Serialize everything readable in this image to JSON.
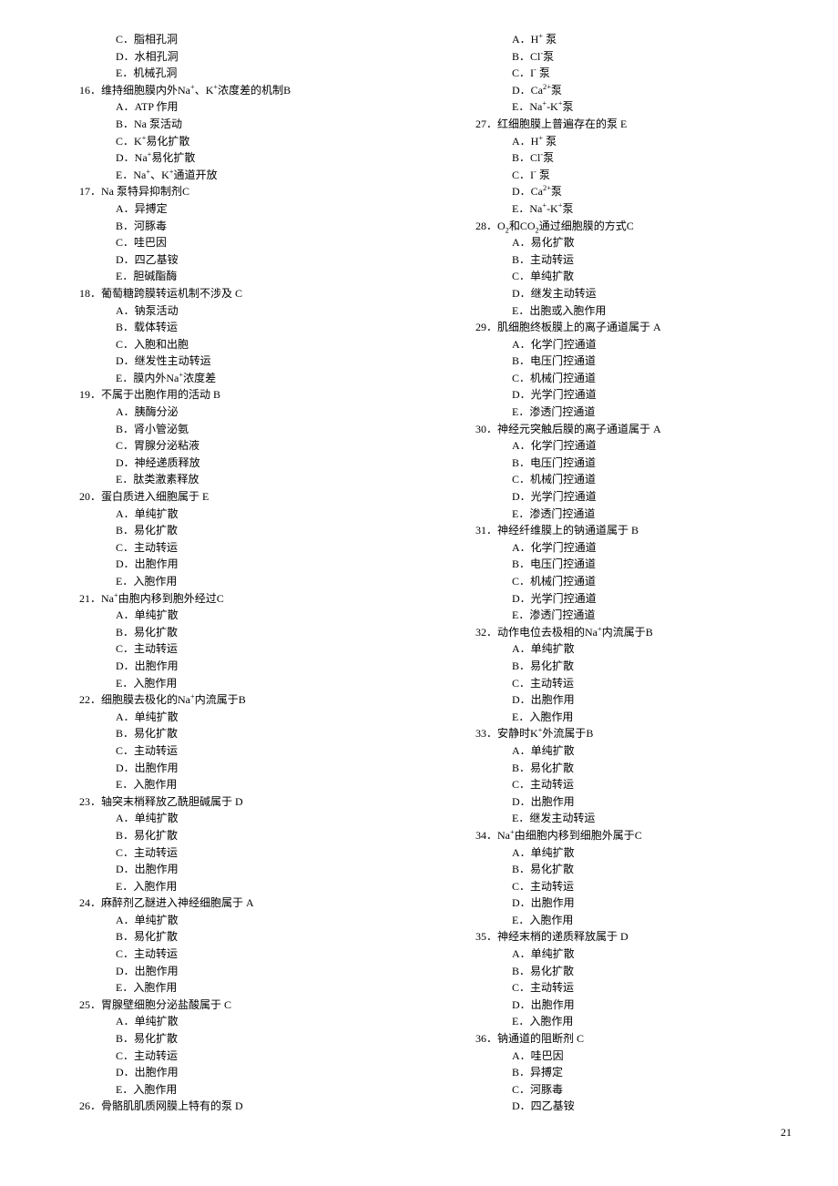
{
  "page_number": "21",
  "left_column": [
    {
      "type": "option",
      "key": "C",
      "text": "脂相孔洞"
    },
    {
      "type": "option",
      "key": "D",
      "text": "水相孔洞"
    },
    {
      "type": "option",
      "key": "E",
      "text": "机械孔洞"
    },
    {
      "type": "question",
      "num": "16",
      "text": "维持细胞膜内外Na<sup>+</sup>、K<sup>+</sup>浓度差的机制B"
    },
    {
      "type": "option",
      "key": "A",
      "text": "ATP 作用"
    },
    {
      "type": "option",
      "key": "B",
      "text": "Na 泵活动"
    },
    {
      "type": "option",
      "key": "C",
      "text": "K<sup>+</sup>易化扩散"
    },
    {
      "type": "option",
      "key": "D",
      "text": "Na<sup>+</sup>易化扩散"
    },
    {
      "type": "option",
      "key": "E",
      "text": "Na<sup>+</sup>、K<sup>+</sup>通道开放"
    },
    {
      "type": "question",
      "num": "17",
      "text": "Na 泵特异抑制剂C"
    },
    {
      "type": "option",
      "key": "A",
      "text": "异搏定"
    },
    {
      "type": "option",
      "key": "B",
      "text": "河豚毒"
    },
    {
      "type": "option",
      "key": "C",
      "text": "哇巴因"
    },
    {
      "type": "option",
      "key": "D",
      "text": "四乙基铵"
    },
    {
      "type": "option",
      "key": "E",
      "text": "胆碱酯酶"
    },
    {
      "type": "question",
      "num": "18",
      "text": "葡萄糖跨膜转运机制不涉及 C"
    },
    {
      "type": "option",
      "key": "A",
      "text": "钠泵活动"
    },
    {
      "type": "option",
      "key": "B",
      "text": "载体转运"
    },
    {
      "type": "option",
      "key": "C",
      "text": "入胞和出胞"
    },
    {
      "type": "option",
      "key": "D",
      "text": "继发性主动转运"
    },
    {
      "type": "option",
      "key": "E",
      "text": "膜内外Na<sup>+</sup>浓度差"
    },
    {
      "type": "question",
      "num": "19",
      "text": "不属于出胞作用的活动 B"
    },
    {
      "type": "option",
      "key": "A",
      "text": "胰酶分泌"
    },
    {
      "type": "option",
      "key": "B",
      "text": "肾小管泌氨"
    },
    {
      "type": "option",
      "key": "C",
      "text": "胃腺分泌粘液"
    },
    {
      "type": "option",
      "key": "D",
      "text": "神经递质释放"
    },
    {
      "type": "option",
      "key": "E",
      "text": "肽类激素释放"
    },
    {
      "type": "question",
      "num": "20",
      "text": "蛋白质进入细胞属于 E"
    },
    {
      "type": "option",
      "key": "A",
      "text": "单纯扩散"
    },
    {
      "type": "option",
      "key": "B",
      "text": "易化扩散"
    },
    {
      "type": "option",
      "key": "C",
      "text": "主动转运"
    },
    {
      "type": "option",
      "key": "D",
      "text": "出胞作用"
    },
    {
      "type": "option",
      "key": "E",
      "text": "入胞作用"
    },
    {
      "type": "question",
      "num": "21",
      "text": "Na<sup>+</sup>由胞内移到胞外经过C"
    },
    {
      "type": "option",
      "key": "A",
      "text": "单纯扩散"
    },
    {
      "type": "option",
      "key": "B",
      "text": "易化扩散"
    },
    {
      "type": "option",
      "key": "C",
      "text": "主动转运"
    },
    {
      "type": "option",
      "key": "D",
      "text": "出胞作用"
    },
    {
      "type": "option",
      "key": "E",
      "text": "入胞作用"
    },
    {
      "type": "question",
      "num": "22",
      "text": "细胞膜去极化的Na<sup>+</sup>内流属于B"
    },
    {
      "type": "option",
      "key": "A",
      "text": "单纯扩散"
    },
    {
      "type": "option",
      "key": "B",
      "text": "易化扩散"
    },
    {
      "type": "option",
      "key": "C",
      "text": "主动转运"
    },
    {
      "type": "option",
      "key": "D",
      "text": "出胞作用"
    },
    {
      "type": "option",
      "key": "E",
      "text": "入胞作用"
    },
    {
      "type": "question",
      "num": "23",
      "text": "轴突末梢释放乙酰胆碱属于 D"
    },
    {
      "type": "option",
      "key": "A",
      "text": "单纯扩散"
    },
    {
      "type": "option",
      "key": "B",
      "text": "易化扩散"
    },
    {
      "type": "option",
      "key": "C",
      "text": "主动转运"
    },
    {
      "type": "option",
      "key": "D",
      "text": "出胞作用"
    },
    {
      "type": "option",
      "key": "E",
      "text": "入胞作用"
    },
    {
      "type": "question",
      "num": "24",
      "text": "麻醉剂乙醚进入神经细胞属于 A"
    },
    {
      "type": "option",
      "key": "A",
      "text": "单纯扩散"
    },
    {
      "type": "option",
      "key": "B",
      "text": "易化扩散"
    },
    {
      "type": "option",
      "key": "C",
      "text": "主动转运"
    },
    {
      "type": "option",
      "key": "D",
      "text": "出胞作用"
    },
    {
      "type": "option",
      "key": "E",
      "text": "入胞作用"
    },
    {
      "type": "question",
      "num": "25",
      "text": "胃腺壁细胞分泌盐酸属于 C"
    },
    {
      "type": "option",
      "key": "A",
      "text": "单纯扩散"
    },
    {
      "type": "option",
      "key": "B",
      "text": "易化扩散"
    },
    {
      "type": "option",
      "key": "C",
      "text": "主动转运"
    },
    {
      "type": "option",
      "key": "D",
      "text": "出胞作用"
    },
    {
      "type": "option",
      "key": "E",
      "text": "入胞作用"
    },
    {
      "type": "question",
      "num": "26",
      "text": "骨骼肌肌质网膜上特有的泵 D"
    }
  ],
  "right_column": [
    {
      "type": "option",
      "key": "A",
      "text": "H<sup>+</sup> 泵"
    },
    {
      "type": "option",
      "key": "B",
      "text": "Cl<sup>-</sup>泵"
    },
    {
      "type": "option",
      "key": "C",
      "text": "I<sup>-</sup> 泵"
    },
    {
      "type": "option",
      "key": "D",
      "text": "Ca<sup>2+</sup>泵"
    },
    {
      "type": "option",
      "key": "E",
      "text": "Na<sup>+</sup>-K<sup>+</sup>泵"
    },
    {
      "type": "question",
      "num": "27",
      "text": "红细胞膜上普遍存在的泵 E"
    },
    {
      "type": "option",
      "key": "A",
      "text": "H<sup>+</sup> 泵"
    },
    {
      "type": "option",
      "key": "B",
      "text": "Cl<sup>-</sup>泵"
    },
    {
      "type": "option",
      "key": "C",
      "text": "I<sup>-</sup> 泵"
    },
    {
      "type": "option",
      "key": "D",
      "text": "Ca<sup>2+</sup>泵"
    },
    {
      "type": "option",
      "key": "E",
      "text": "Na<sup>+</sup>-K<sup>+</sup>泵"
    },
    {
      "type": "question",
      "num": "28",
      "text": "O<sub>2</sub>和CO<sub>2</sub>通过细胞膜的方式C"
    },
    {
      "type": "option",
      "key": "A",
      "text": "易化扩散"
    },
    {
      "type": "option",
      "key": "B",
      "text": "主动转运"
    },
    {
      "type": "option",
      "key": "C",
      "text": "单纯扩散"
    },
    {
      "type": "option",
      "key": "D",
      "text": "继发主动转运"
    },
    {
      "type": "option",
      "key": "E",
      "text": "出胞或入胞作用"
    },
    {
      "type": "question",
      "num": "29",
      "text": "肌细胞终板膜上的离子通道属于 A"
    },
    {
      "type": "option",
      "key": "A",
      "text": "化学门控通道"
    },
    {
      "type": "option",
      "key": "B",
      "text": "电压门控通道"
    },
    {
      "type": "option",
      "key": "C",
      "text": "机械门控通道"
    },
    {
      "type": "option",
      "key": "D",
      "text": "光学门控通道"
    },
    {
      "type": "option",
      "key": "E",
      "text": "渗透门控通道"
    },
    {
      "type": "question",
      "num": "30",
      "text": "神经元突触后膜的离子通道属于 A"
    },
    {
      "type": "option",
      "key": "A",
      "text": "化学门控通道"
    },
    {
      "type": "option",
      "key": "B",
      "text": "电压门控通道"
    },
    {
      "type": "option",
      "key": "C",
      "text": "机械门控通道"
    },
    {
      "type": "option",
      "key": "D",
      "text": "光学门控通道"
    },
    {
      "type": "option",
      "key": "E",
      "text": "渗透门控通道"
    },
    {
      "type": "question",
      "num": "31",
      "text": "神经纤维膜上的钠通道属于 B"
    },
    {
      "type": "option",
      "key": "A",
      "text": "化学门控通道"
    },
    {
      "type": "option",
      "key": "B",
      "text": "电压门控通道"
    },
    {
      "type": "option",
      "key": "C",
      "text": "机械门控通道"
    },
    {
      "type": "option",
      "key": "D",
      "text": "光学门控通道"
    },
    {
      "type": "option",
      "key": "E",
      "text": "渗透门控通道"
    },
    {
      "type": "question",
      "num": "32",
      "text": "动作电位去极相的Na<sup>+</sup>内流属于B"
    },
    {
      "type": "option",
      "key": "A",
      "text": "单纯扩散"
    },
    {
      "type": "option",
      "key": "B",
      "text": "易化扩散"
    },
    {
      "type": "option",
      "key": "C",
      "text": "主动转运"
    },
    {
      "type": "option",
      "key": "D",
      "text": "出胞作用"
    },
    {
      "type": "option",
      "key": "E",
      "text": "入胞作用"
    },
    {
      "type": "question",
      "num": "33",
      "text": "安静时K<sup>+</sup>外流属于B"
    },
    {
      "type": "option",
      "key": "A",
      "text": "单纯扩散"
    },
    {
      "type": "option",
      "key": "B",
      "text": "易化扩散"
    },
    {
      "type": "option",
      "key": "C",
      "text": "主动转运"
    },
    {
      "type": "option",
      "key": "D",
      "text": "出胞作用"
    },
    {
      "type": "option",
      "key": "E",
      "text": "继发主动转运"
    },
    {
      "type": "question",
      "num": "34",
      "text": "Na<sup>+</sup>由细胞内移到细胞外属于C"
    },
    {
      "type": "option",
      "key": "A",
      "text": "单纯扩散"
    },
    {
      "type": "option",
      "key": "B",
      "text": "易化扩散"
    },
    {
      "type": "option",
      "key": "C",
      "text": "主动转运"
    },
    {
      "type": "option",
      "key": "D",
      "text": "出胞作用"
    },
    {
      "type": "option",
      "key": "E",
      "text": "入胞作用"
    },
    {
      "type": "question",
      "num": "35",
      "text": "神经末梢的递质释放属于 D"
    },
    {
      "type": "option",
      "key": "A",
      "text": "单纯扩散"
    },
    {
      "type": "option",
      "key": "B",
      "text": "易化扩散"
    },
    {
      "type": "option",
      "key": "C",
      "text": "主动转运"
    },
    {
      "type": "option",
      "key": "D",
      "text": "出胞作用"
    },
    {
      "type": "option",
      "key": "E",
      "text": "入胞作用"
    },
    {
      "type": "question",
      "num": "36",
      "text": "钠通道的阻断剂 C"
    },
    {
      "type": "option",
      "key": "A",
      "text": "哇巴因"
    },
    {
      "type": "option",
      "key": "B",
      "text": "异搏定"
    },
    {
      "type": "option",
      "key": "C",
      "text": "河豚毒"
    },
    {
      "type": "option",
      "key": "D",
      "text": "四乙基铵"
    }
  ]
}
